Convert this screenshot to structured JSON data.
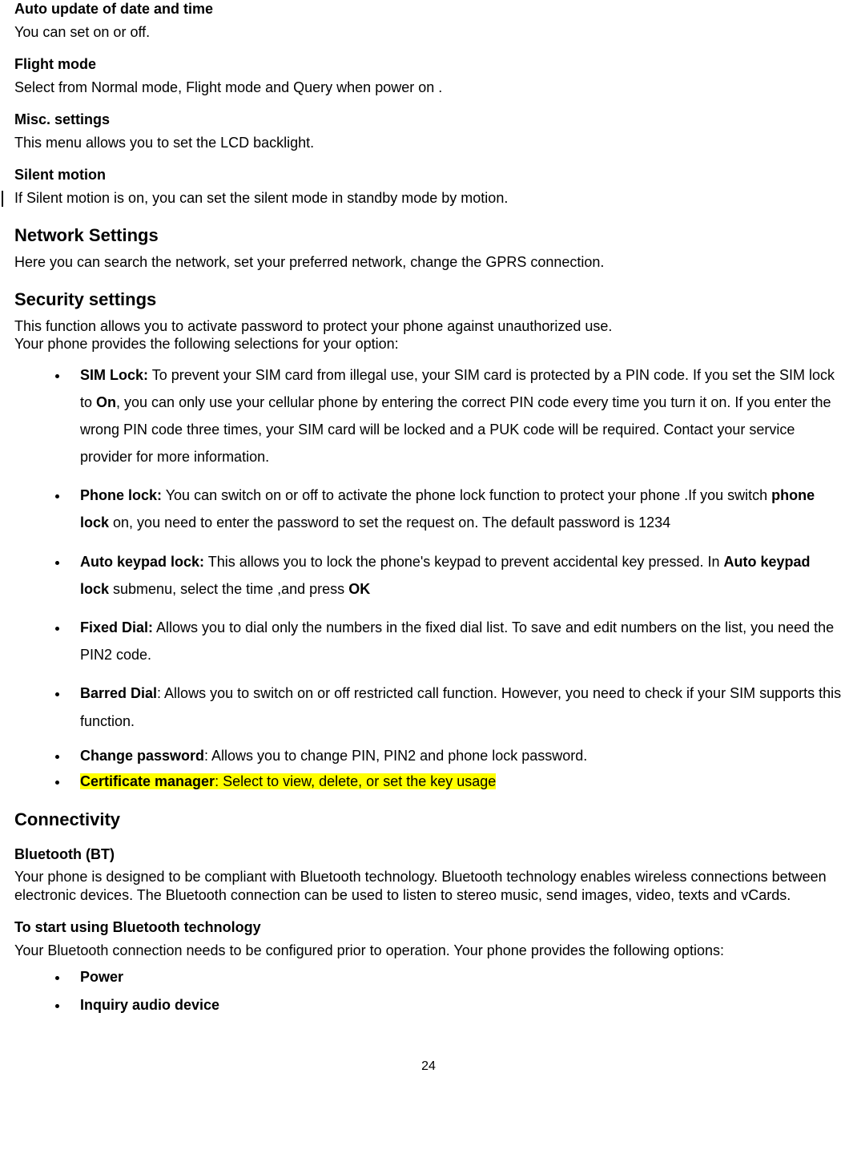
{
  "sections": {
    "auto_update": {
      "heading": "Auto update of date and time",
      "body": "You can set on or off."
    },
    "flight_mode": {
      "heading": "Flight mode",
      "body": "Select from Normal mode, Flight mode and Query when power on ."
    },
    "misc": {
      "heading": "Misc. settings",
      "body": "This menu allows you to set the LCD backlight."
    },
    "silent_motion": {
      "heading": "Silent motion",
      "body": "If Silent motion is on, you can set the silent mode in standby mode by motion."
    },
    "network": {
      "heading": "Network Settings",
      "body": "Here you can search the network, set your preferred network, change the GPRS connection."
    },
    "security": {
      "heading": "Security settings",
      "body1": "This function allows you to activate password to protect your phone against unauthorized use.",
      "body2": "Your phone provides the following selections for your option:",
      "items": {
        "sim_lock": {
          "label": "SIM Lock:",
          "t1": " To prevent your SIM card from illegal use, your SIM card is protected by a PIN code. If you set the SIM lock to ",
          "on": "On",
          "t2": ", you can only use your cellular phone by entering the correct PIN code every time you turn it on. If you enter the wrong PIN code three times, your SIM card will be locked and a PUK code will be required. Contact your service provider for more information."
        },
        "phone_lock": {
          "label": "Phone lock:",
          "t1": " You can switch on or off to activate the phone lock function to protect your phone .If you switch ",
          "pl": "phone lock",
          "t2": " on, you need to enter the password to set the request on. The default password is 1234"
        },
        "auto_keypad": {
          "label": "Auto keypad lock:",
          "t1": " This allows you to lock the phone's keypad to prevent accidental key pressed. In ",
          "akl": "Auto keypad lock",
          "t2": " submenu, select the time ,and press ",
          "ok": "OK"
        },
        "fixed_dial": {
          "label": "Fixed Dial:",
          "t1": " Allows you to dial only the numbers in the fixed dial list. To save and edit numbers on the list, you need the PIN2 code."
        },
        "barred_dial": {
          "label": "Barred Dial",
          "t1": ": Allows you to switch on or off restricted call function. However, you need to check if your SIM supports this function."
        },
        "change_pw": {
          "label": "Change password",
          "t1": ": Allows you to change PIN, PIN2 and phone lock password."
        },
        "cert_mgr": {
          "label": "Certificate manager",
          "t1": ": Select to view, delete, or set the key usage"
        }
      }
    },
    "connectivity": {
      "heading": "Connectivity",
      "bt": {
        "heading": "Bluetooth (BT)",
        "body": "Your phone is designed to be compliant with Bluetooth technology. Bluetooth technology enables wireless connections between electronic devices. The Bluetooth connection can be used to listen to stereo music, send images, video, texts and vCards."
      },
      "start": {
        "heading": "To start using Bluetooth technology",
        "body": "Your Bluetooth connection needs to be configured prior to operation. Your phone provides the following options:",
        "items": {
          "power": "Power",
          "inquiry": "Inquiry audio device"
        }
      }
    }
  },
  "page_number": "24"
}
